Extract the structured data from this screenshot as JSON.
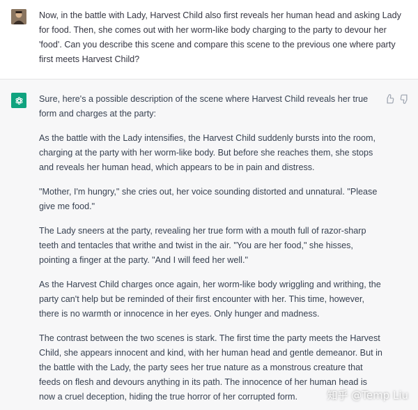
{
  "user_message": {
    "avatar": "user-avatar-photo",
    "text": "Now, in the battle with Lady, Harvest Child also first reveals her human head and asking Lady for food. Then, she comes out with her worm-like body charging to the party to devour her 'food'. Can you describe this scene and compare this scene to the previous one where party first meets Harvest Child?"
  },
  "assistant_message": {
    "avatar": "chatgpt-logo-icon",
    "accent_color": "#10a37f",
    "paragraphs": [
      "Sure, here's a possible description of the scene where Harvest Child reveals her true form and charges at the party:",
      "As the battle with the Lady intensifies, the Harvest Child suddenly bursts into the room, charging at the party with her worm-like body. But before she reaches them, she stops and reveals her human head, which appears to be in pain and distress.",
      "\"Mother, I'm hungry,\" she cries out, her voice sounding distorted and unnatural. \"Please give me food.\"",
      "The Lady sneers at the party, revealing her true form with a mouth full of razor-sharp teeth and tentacles that writhe and twist in the air. \"You are her food,\" she hisses, pointing a finger at the party. \"And I will feed her well.\"",
      "As the Harvest Child charges once again, her worm-like body wriggling and writhing, the party can't help but be reminded of their first encounter with her. This time, however, there is no warmth or innocence in her eyes. Only hunger and madness.",
      "The contrast between the two scenes is stark. The first time the party meets the Harvest Child, she appears innocent and kind, with her human head and gentle demeanor. But in the battle with the Lady, the party sees her true nature as a monstrous creature that feeds on flesh and devours anything in its path. The innocence of her human head is now a cruel deception, hiding the true horror of her corrupted form."
    ],
    "feedback_icons": [
      "thumbs-up-icon",
      "thumbs-down-icon"
    ]
  },
  "watermark": {
    "text": "知乎 @Temp Liu"
  }
}
